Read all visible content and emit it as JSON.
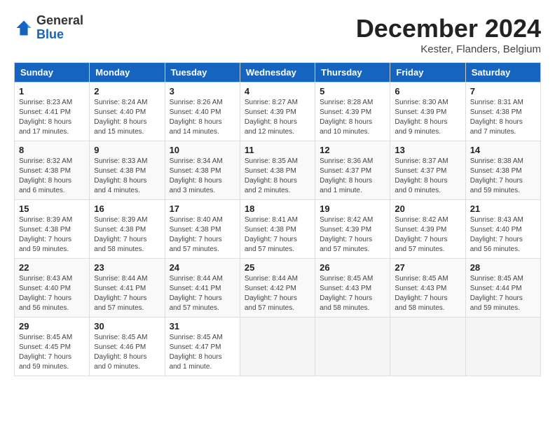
{
  "header": {
    "logo_general": "General",
    "logo_blue": "Blue",
    "month_title": "December 2024",
    "location": "Kester, Flanders, Belgium"
  },
  "calendar": {
    "days_of_week": [
      "Sunday",
      "Monday",
      "Tuesday",
      "Wednesday",
      "Thursday",
      "Friday",
      "Saturday"
    ],
    "weeks": [
      [
        {
          "day": "1",
          "sunrise": "8:23 AM",
          "sunset": "4:41 PM",
          "daylight": "8 hours and 17 minutes."
        },
        {
          "day": "2",
          "sunrise": "8:24 AM",
          "sunset": "4:40 PM",
          "daylight": "8 hours and 15 minutes."
        },
        {
          "day": "3",
          "sunrise": "8:26 AM",
          "sunset": "4:40 PM",
          "daylight": "8 hours and 14 minutes."
        },
        {
          "day": "4",
          "sunrise": "8:27 AM",
          "sunset": "4:39 PM",
          "daylight": "8 hours and 12 minutes."
        },
        {
          "day": "5",
          "sunrise": "8:28 AM",
          "sunset": "4:39 PM",
          "daylight": "8 hours and 10 minutes."
        },
        {
          "day": "6",
          "sunrise": "8:30 AM",
          "sunset": "4:39 PM",
          "daylight": "8 hours and 9 minutes."
        },
        {
          "day": "7",
          "sunrise": "8:31 AM",
          "sunset": "4:38 PM",
          "daylight": "8 hours and 7 minutes."
        }
      ],
      [
        {
          "day": "8",
          "sunrise": "8:32 AM",
          "sunset": "4:38 PM",
          "daylight": "8 hours and 6 minutes."
        },
        {
          "day": "9",
          "sunrise": "8:33 AM",
          "sunset": "4:38 PM",
          "daylight": "8 hours and 4 minutes."
        },
        {
          "day": "10",
          "sunrise": "8:34 AM",
          "sunset": "4:38 PM",
          "daylight": "8 hours and 3 minutes."
        },
        {
          "day": "11",
          "sunrise": "8:35 AM",
          "sunset": "4:38 PM",
          "daylight": "8 hours and 2 minutes."
        },
        {
          "day": "12",
          "sunrise": "8:36 AM",
          "sunset": "4:37 PM",
          "daylight": "8 hours and 1 minute."
        },
        {
          "day": "13",
          "sunrise": "8:37 AM",
          "sunset": "4:37 PM",
          "daylight": "8 hours and 0 minutes."
        },
        {
          "day": "14",
          "sunrise": "8:38 AM",
          "sunset": "4:38 PM",
          "daylight": "7 hours and 59 minutes."
        }
      ],
      [
        {
          "day": "15",
          "sunrise": "8:39 AM",
          "sunset": "4:38 PM",
          "daylight": "7 hours and 59 minutes."
        },
        {
          "day": "16",
          "sunrise": "8:39 AM",
          "sunset": "4:38 PM",
          "daylight": "7 hours and 58 minutes."
        },
        {
          "day": "17",
          "sunrise": "8:40 AM",
          "sunset": "4:38 PM",
          "daylight": "7 hours and 57 minutes."
        },
        {
          "day": "18",
          "sunrise": "8:41 AM",
          "sunset": "4:38 PM",
          "daylight": "7 hours and 57 minutes."
        },
        {
          "day": "19",
          "sunrise": "8:42 AM",
          "sunset": "4:39 PM",
          "daylight": "7 hours and 57 minutes."
        },
        {
          "day": "20",
          "sunrise": "8:42 AM",
          "sunset": "4:39 PM",
          "daylight": "7 hours and 57 minutes."
        },
        {
          "day": "21",
          "sunrise": "8:43 AM",
          "sunset": "4:40 PM",
          "daylight": "7 hours and 56 minutes."
        }
      ],
      [
        {
          "day": "22",
          "sunrise": "8:43 AM",
          "sunset": "4:40 PM",
          "daylight": "7 hours and 56 minutes."
        },
        {
          "day": "23",
          "sunrise": "8:44 AM",
          "sunset": "4:41 PM",
          "daylight": "7 hours and 57 minutes."
        },
        {
          "day": "24",
          "sunrise": "8:44 AM",
          "sunset": "4:41 PM",
          "daylight": "7 hours and 57 minutes."
        },
        {
          "day": "25",
          "sunrise": "8:44 AM",
          "sunset": "4:42 PM",
          "daylight": "7 hours and 57 minutes."
        },
        {
          "day": "26",
          "sunrise": "8:45 AM",
          "sunset": "4:43 PM",
          "daylight": "7 hours and 58 minutes."
        },
        {
          "day": "27",
          "sunrise": "8:45 AM",
          "sunset": "4:43 PM",
          "daylight": "7 hours and 58 minutes."
        },
        {
          "day": "28",
          "sunrise": "8:45 AM",
          "sunset": "4:44 PM",
          "daylight": "7 hours and 59 minutes."
        }
      ],
      [
        {
          "day": "29",
          "sunrise": "8:45 AM",
          "sunset": "4:45 PM",
          "daylight": "7 hours and 59 minutes."
        },
        {
          "day": "30",
          "sunrise": "8:45 AM",
          "sunset": "4:46 PM",
          "daylight": "8 hours and 0 minutes."
        },
        {
          "day": "31",
          "sunrise": "8:45 AM",
          "sunset": "4:47 PM",
          "daylight": "8 hours and 1 minute."
        },
        null,
        null,
        null,
        null
      ]
    ]
  }
}
